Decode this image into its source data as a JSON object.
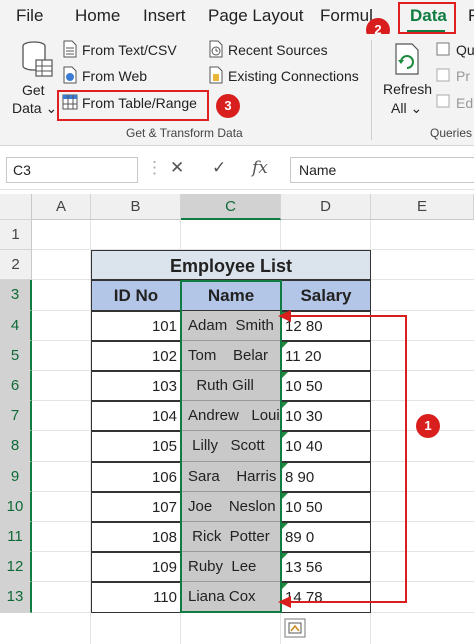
{
  "ribbon_tabs": {
    "file": "File",
    "home": "Home",
    "insert": "Insert",
    "page_layout": "Page Layout",
    "formulas": "Formul",
    "data": "Data",
    "extra": "R"
  },
  "get_data": {
    "line1": "Get",
    "line2": "Data ⌄"
  },
  "get_transform": {
    "from_text_csv": "From Text/CSV",
    "from_web": "From Web",
    "from_table_range": "From Table/Range",
    "recent_sources": "Recent Sources",
    "existing_connections": "Existing Connections",
    "group_label": "Get & Transform Data"
  },
  "queries": {
    "refresh_line1": "Refresh",
    "refresh_line2": "All ⌄",
    "item1": "Qu",
    "item2": "Pr",
    "item3": "Ed",
    "group_label": "Queries"
  },
  "callouts": {
    "c1": "1",
    "c2": "2",
    "c3": "3"
  },
  "formula_bar": {
    "name_box": "C3",
    "cancel_icon": "✕",
    "enter_icon": "✓",
    "fx_label": "fx",
    "content": "Name"
  },
  "columns": [
    "A",
    "B",
    "C",
    "D",
    "E"
  ],
  "rows": [
    "1",
    "2",
    "3",
    "4",
    "5",
    "6",
    "7",
    "8",
    "9",
    "10",
    "11",
    "12",
    "13"
  ],
  "table": {
    "title": "Employee List",
    "headers": {
      "id": "ID No",
      "name": "Name",
      "salary": "Salary"
    },
    "records": [
      {
        "id": "101",
        "name": "Adam  Smith",
        "salary": "12 80"
      },
      {
        "id": "102",
        "name": "Tom    Belar",
        "salary": "11 20"
      },
      {
        "id": "103",
        "name": "  Ruth Gill",
        "salary": "10 50"
      },
      {
        "id": "104",
        "name": "Andrew   Louis",
        "salary": "10 30"
      },
      {
        "id": "105",
        "name": " Lilly   Scott",
        "salary": "10 40"
      },
      {
        "id": "106",
        "name": "Sara    Harris",
        "salary": "8 90"
      },
      {
        "id": "107",
        "name": "Joe    Neslon",
        "salary": "10 50"
      },
      {
        "id": "108",
        "name": " Rick  Potter",
        "salary": "89 0"
      },
      {
        "id": "109",
        "name": "Ruby  Lee",
        "salary": "13 56"
      },
      {
        "id": "110",
        "name": "Liana Cox",
        "salary": "14 78"
      }
    ]
  },
  "colors": {
    "excel_green": "#107c41",
    "callout_red": "#d91e1e",
    "header_blue": "#b4c6e7"
  }
}
